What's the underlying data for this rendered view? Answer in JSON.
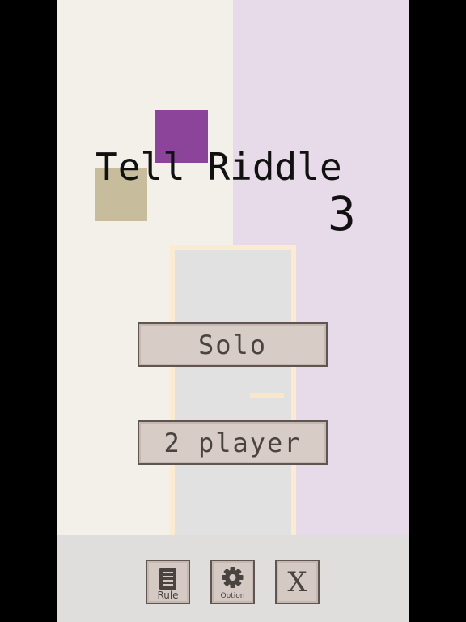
{
  "game": {
    "title": "Tell Riddle",
    "title_number": "3"
  },
  "menu": {
    "solo_label": "Solo",
    "two_player_label": "2 player"
  },
  "toolbar": {
    "rule_label": "Rule",
    "option_label": "Option",
    "close_label": "X"
  },
  "icons": {
    "rule": "document-icon",
    "option": "gear-icon"
  },
  "colors": {
    "wall_left": "#f3efe9",
    "wall_right": "#e7dbea",
    "floor": "#dfdedc",
    "door": "#e1e1e1",
    "door_frame": "#fbebd0",
    "purple_square": "#8c439a",
    "tan_square": "#c7bd9c",
    "button_fill": "#d8ccc6",
    "button_border": "#5f5652"
  }
}
